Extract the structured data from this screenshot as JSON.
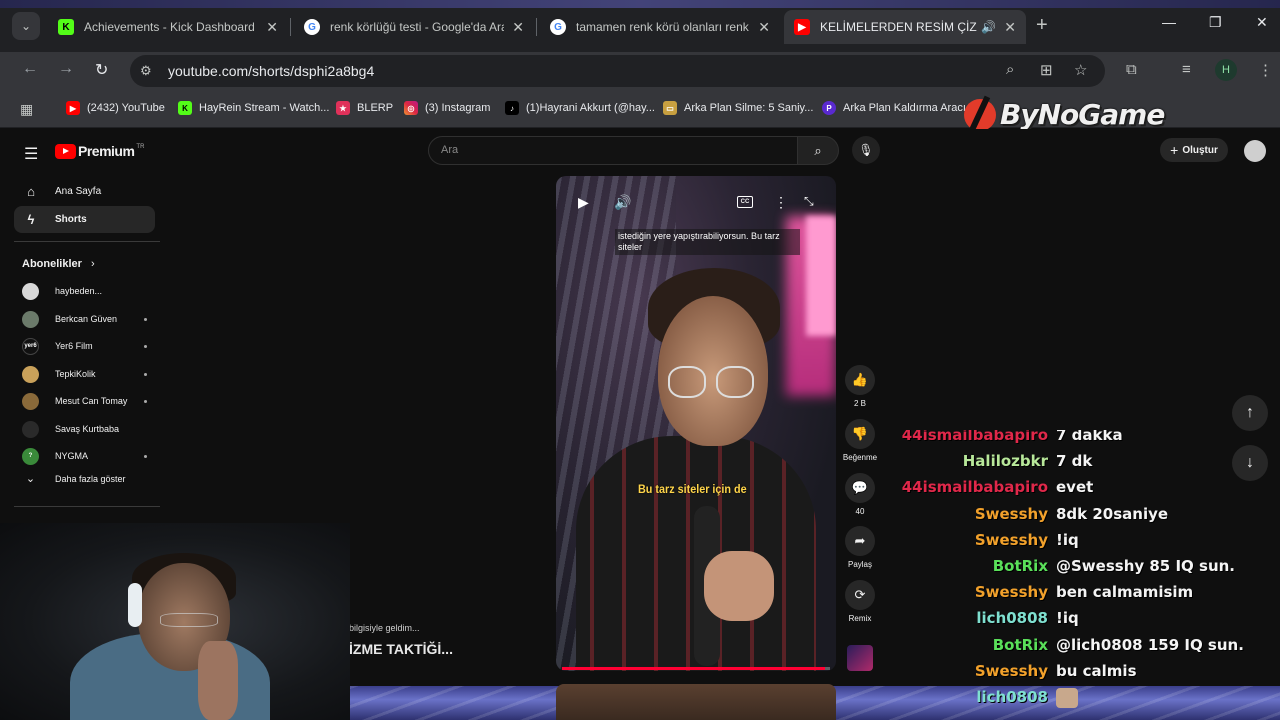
{
  "browser": {
    "tabs": [
      {
        "title": "Achievements - Kick Dashboard",
        "favicon": "kick-icon",
        "active": false
      },
      {
        "title": "renk körlüğü testi - Google'da Ara",
        "favicon": "google-icon",
        "active": false
      },
      {
        "title": "tamamen renk körü olanları renk tonla",
        "favicon": "google-icon",
        "active": false
      },
      {
        "title": "KELİMELERDEN RESİM ÇİZME TAK",
        "favicon": "youtube-icon",
        "active": true
      }
    ],
    "url": "youtube.com/shorts/dsphi2a8bg4",
    "profile_initial": "H",
    "bookmarks": [
      {
        "label": "(2432) YouTube",
        "icon": "youtube-icon"
      },
      {
        "label": "HayRein Stream - Watch...",
        "icon": "kick-icon"
      },
      {
        "label": "BLERP",
        "icon": "blerp-icon"
      },
      {
        "label": "(3) Instagram",
        "icon": "instagram-icon"
      },
      {
        "label": "(1)Hayrani Akkurt (@hay...",
        "icon": "tiktok-icon"
      },
      {
        "label": "Arka Plan Silme: 5 Saniy...",
        "icon": "removebg-icon"
      },
      {
        "label": "Arka Plan Kaldırma Aracı...",
        "icon": "picsart-icon"
      }
    ]
  },
  "watermark": {
    "text": "ByNoGame"
  },
  "youtube": {
    "logo_text": "Premium",
    "logo_sup": "TR",
    "search_placeholder": "Ara",
    "create_label": "Oluştur",
    "nav": [
      {
        "label": "Ana Sayfa",
        "icon": "home-icon",
        "active": false
      },
      {
        "label": "Shorts",
        "icon": "shorts-icon",
        "active": true
      }
    ],
    "subscriptions_heading": "Abonelikler",
    "subscriptions": [
      {
        "name": "haybeden...",
        "dot": false,
        "color": "#d8d8d8"
      },
      {
        "name": "Berkcan Güven",
        "dot": true,
        "color": "#6b7a6a"
      },
      {
        "name": "Yer6 Film",
        "dot": true,
        "color": "#111111"
      },
      {
        "name": "TepkiKolik",
        "dot": true,
        "color": "#c9a15a"
      },
      {
        "name": "Mesut Can Tomay",
        "dot": true,
        "color": "#8a6a3a"
      },
      {
        "name": "Savaş Kurtbaba",
        "dot": false,
        "color": "#2a2a2a"
      },
      {
        "name": "NYGMA",
        "dot": true,
        "color": "#3a8a3a"
      }
    ],
    "show_more": "Daha fazla göster",
    "short": {
      "caption_top": "istediğin yere yapıştırabiliyorsun. Bu tarz siteler",
      "caption_mid": "Bu tarz siteler için de",
      "cc_label": "CC",
      "progress": 0.98
    },
    "actions": [
      {
        "icon": "like-icon",
        "label": "2 B"
      },
      {
        "icon": "dislike-icon",
        "label": "Beğenme"
      },
      {
        "icon": "comment-icon",
        "label": "40"
      },
      {
        "icon": "share-icon",
        "label": "Paylaş"
      },
      {
        "icon": "remix-icon",
        "label": "Remix"
      }
    ],
    "video_desc": "bilgisiyle geldim...",
    "video_title": "İZME TAKTİĞİ..."
  },
  "chat": [
    {
      "user": "44ismailbabapiro",
      "msg": "7 dakka",
      "color": "#e0284a"
    },
    {
      "user": "Halilozbkr",
      "msg": "7 dk",
      "color": "#b8e89a"
    },
    {
      "user": "44ismailbabapiro",
      "msg": "evet",
      "color": "#e0284a"
    },
    {
      "user": "Swesshy",
      "msg": "8dk 20saniye",
      "color": "#f2a12b"
    },
    {
      "user": "Swesshy",
      "msg": "!iq",
      "color": "#f2a12b"
    },
    {
      "user": "BotRix",
      "msg": "@Swesshy 85 IQ sun.",
      "color": "#5ae05a"
    },
    {
      "user": "Swesshy",
      "msg": "ben calmamisim",
      "color": "#f2a12b"
    },
    {
      "user": "lich0808",
      "msg": "!iq",
      "color": "#7fe0d0"
    },
    {
      "user": "BotRix",
      "msg": "@lich0808 159 IQ sun.",
      "color": "#5ae05a"
    },
    {
      "user": "Swesshy",
      "msg": "bu calmis",
      "color": "#f2a12b"
    },
    {
      "user": "lich0808",
      "msg": "",
      "color": "#7fe0d0",
      "emote": true
    }
  ]
}
